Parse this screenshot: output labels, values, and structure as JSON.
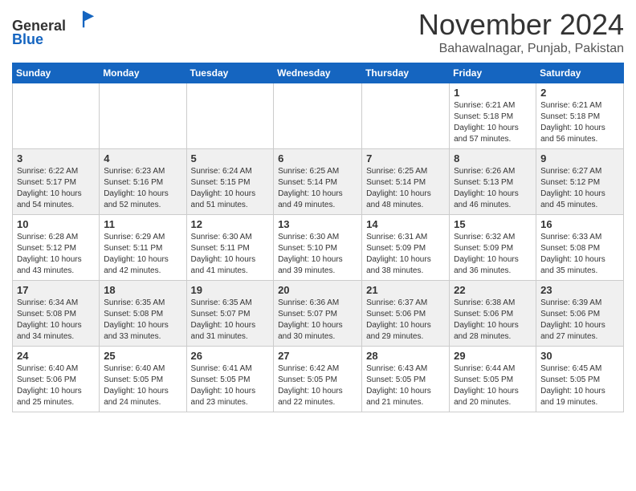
{
  "header": {
    "logo_line1": "General",
    "logo_line2": "Blue",
    "month": "November 2024",
    "location": "Bahawalnagar, Punjab, Pakistan"
  },
  "days_of_week": [
    "Sunday",
    "Monday",
    "Tuesday",
    "Wednesday",
    "Thursday",
    "Friday",
    "Saturday"
  ],
  "weeks": [
    [
      {
        "num": "",
        "info": ""
      },
      {
        "num": "",
        "info": ""
      },
      {
        "num": "",
        "info": ""
      },
      {
        "num": "",
        "info": ""
      },
      {
        "num": "",
        "info": ""
      },
      {
        "num": "1",
        "info": "Sunrise: 6:21 AM\nSunset: 5:18 PM\nDaylight: 10 hours\nand 57 minutes."
      },
      {
        "num": "2",
        "info": "Sunrise: 6:21 AM\nSunset: 5:18 PM\nDaylight: 10 hours\nand 56 minutes."
      }
    ],
    [
      {
        "num": "3",
        "info": "Sunrise: 6:22 AM\nSunset: 5:17 PM\nDaylight: 10 hours\nand 54 minutes."
      },
      {
        "num": "4",
        "info": "Sunrise: 6:23 AM\nSunset: 5:16 PM\nDaylight: 10 hours\nand 52 minutes."
      },
      {
        "num": "5",
        "info": "Sunrise: 6:24 AM\nSunset: 5:15 PM\nDaylight: 10 hours\nand 51 minutes."
      },
      {
        "num": "6",
        "info": "Sunrise: 6:25 AM\nSunset: 5:14 PM\nDaylight: 10 hours\nand 49 minutes."
      },
      {
        "num": "7",
        "info": "Sunrise: 6:25 AM\nSunset: 5:14 PM\nDaylight: 10 hours\nand 48 minutes."
      },
      {
        "num": "8",
        "info": "Sunrise: 6:26 AM\nSunset: 5:13 PM\nDaylight: 10 hours\nand 46 minutes."
      },
      {
        "num": "9",
        "info": "Sunrise: 6:27 AM\nSunset: 5:12 PM\nDaylight: 10 hours\nand 45 minutes."
      }
    ],
    [
      {
        "num": "10",
        "info": "Sunrise: 6:28 AM\nSunset: 5:12 PM\nDaylight: 10 hours\nand 43 minutes."
      },
      {
        "num": "11",
        "info": "Sunrise: 6:29 AM\nSunset: 5:11 PM\nDaylight: 10 hours\nand 42 minutes."
      },
      {
        "num": "12",
        "info": "Sunrise: 6:30 AM\nSunset: 5:11 PM\nDaylight: 10 hours\nand 41 minutes."
      },
      {
        "num": "13",
        "info": "Sunrise: 6:30 AM\nSunset: 5:10 PM\nDaylight: 10 hours\nand 39 minutes."
      },
      {
        "num": "14",
        "info": "Sunrise: 6:31 AM\nSunset: 5:09 PM\nDaylight: 10 hours\nand 38 minutes."
      },
      {
        "num": "15",
        "info": "Sunrise: 6:32 AM\nSunset: 5:09 PM\nDaylight: 10 hours\nand 36 minutes."
      },
      {
        "num": "16",
        "info": "Sunrise: 6:33 AM\nSunset: 5:08 PM\nDaylight: 10 hours\nand 35 minutes."
      }
    ],
    [
      {
        "num": "17",
        "info": "Sunrise: 6:34 AM\nSunset: 5:08 PM\nDaylight: 10 hours\nand 34 minutes."
      },
      {
        "num": "18",
        "info": "Sunrise: 6:35 AM\nSunset: 5:08 PM\nDaylight: 10 hours\nand 33 minutes."
      },
      {
        "num": "19",
        "info": "Sunrise: 6:35 AM\nSunset: 5:07 PM\nDaylight: 10 hours\nand 31 minutes."
      },
      {
        "num": "20",
        "info": "Sunrise: 6:36 AM\nSunset: 5:07 PM\nDaylight: 10 hours\nand 30 minutes."
      },
      {
        "num": "21",
        "info": "Sunrise: 6:37 AM\nSunset: 5:06 PM\nDaylight: 10 hours\nand 29 minutes."
      },
      {
        "num": "22",
        "info": "Sunrise: 6:38 AM\nSunset: 5:06 PM\nDaylight: 10 hours\nand 28 minutes."
      },
      {
        "num": "23",
        "info": "Sunrise: 6:39 AM\nSunset: 5:06 PM\nDaylight: 10 hours\nand 27 minutes."
      }
    ],
    [
      {
        "num": "24",
        "info": "Sunrise: 6:40 AM\nSunset: 5:06 PM\nDaylight: 10 hours\nand 25 minutes."
      },
      {
        "num": "25",
        "info": "Sunrise: 6:40 AM\nSunset: 5:05 PM\nDaylight: 10 hours\nand 24 minutes."
      },
      {
        "num": "26",
        "info": "Sunrise: 6:41 AM\nSunset: 5:05 PM\nDaylight: 10 hours\nand 23 minutes."
      },
      {
        "num": "27",
        "info": "Sunrise: 6:42 AM\nSunset: 5:05 PM\nDaylight: 10 hours\nand 22 minutes."
      },
      {
        "num": "28",
        "info": "Sunrise: 6:43 AM\nSunset: 5:05 PM\nDaylight: 10 hours\nand 21 minutes."
      },
      {
        "num": "29",
        "info": "Sunrise: 6:44 AM\nSunset: 5:05 PM\nDaylight: 10 hours\nand 20 minutes."
      },
      {
        "num": "30",
        "info": "Sunrise: 6:45 AM\nSunset: 5:05 PM\nDaylight: 10 hours\nand 19 minutes."
      }
    ]
  ]
}
